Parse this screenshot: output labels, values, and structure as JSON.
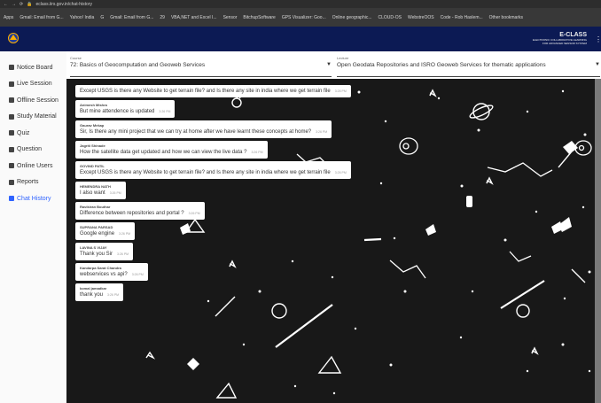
{
  "browser": {
    "url": "eclass.iirs.gov.in/chat-history",
    "bookmarks": [
      "Apps",
      "Gmail: Email from G...",
      "Yahoo! India",
      "G",
      "Gmail: Email from G...",
      "29",
      "VBA,NET and Excel I...",
      "Sensor",
      "BitchupSoftware",
      "GPS Visualizer: Goo...",
      "Online geographic...",
      "CLOUD-OS",
      "WebstreOOS",
      "Code - Rob Haslem...",
      "Other bookmarks"
    ]
  },
  "app": {
    "brand": "E-CLASS",
    "brand_sub_1": "ELECTRONIC COLLABORATIVE LEARNING",
    "brand_sub_2": "FOR ADVANCED SENSOR SYSTEM"
  },
  "sidebar": {
    "items": [
      {
        "label": "Notice Board",
        "icon": "notice-board-icon"
      },
      {
        "label": "Live Session",
        "icon": "live-session-icon"
      },
      {
        "label": "Offline Session",
        "icon": "offline-session-icon"
      },
      {
        "label": "Study Material",
        "icon": "study-material-icon"
      },
      {
        "label": "Quiz",
        "icon": "quiz-icon"
      },
      {
        "label": "Question",
        "icon": "question-icon"
      },
      {
        "label": "Online Users",
        "icon": "online-users-icon"
      },
      {
        "label": "Reports",
        "icon": "reports-icon"
      },
      {
        "label": "Chat History",
        "icon": "chat-history-icon",
        "active": true
      }
    ]
  },
  "course": {
    "label": "Course",
    "value": "72: Basics of Geocomputation and Geoweb Services"
  },
  "lecture": {
    "label": "Lecture",
    "value": "Open Geodata Repositories and ISRO Geoweb Services for thematic applications"
  },
  "messages": [
    {
      "author": "",
      "text": "Except USGS is there any Website to get terrain file? and Is there any site in india where we get terrain file",
      "time": "3:26 PM"
    },
    {
      "author": "Animesh Mishra",
      "text": "But mine attendence is updated",
      "time": "3:26 PM"
    },
    {
      "author": "Gaurav Mekap",
      "text": "Sir, Is there any mini project that we can try at home after we have learnt these concepts at home?",
      "time": "3:26 PM"
    },
    {
      "author": "Jagriti Shinade",
      "text": "How the satellite data get updated and how we can view the live data ?",
      "time": "3:26 PM"
    },
    {
      "author": "GOVIND PATIL",
      "text": "Except USGS is there any Website to get terrain file? and Is there any site in india where we get terrain file",
      "time": "3:26 PM"
    },
    {
      "author": "HEMENDRA NATH",
      "text": "I also want",
      "time": "3:26 PM"
    },
    {
      "author": "Ravikiran Bouthar",
      "text": "Difference between repositories and portal ?",
      "time": "3:26 PM"
    },
    {
      "author": "SUPRANA PARSAD",
      "text": "Google engine",
      "time": "3:26 PM"
    },
    {
      "author": "LAVINA S VIJAY",
      "text": "Thank you Sir",
      "time": "3:26 PM"
    },
    {
      "author": "Kandarpa Sarat Chandra",
      "text": "webservices vs api?",
      "time": "3:26 PM"
    },
    {
      "author": "komal jamadkar",
      "text": "thank you",
      "time": "3:26 PM"
    }
  ]
}
